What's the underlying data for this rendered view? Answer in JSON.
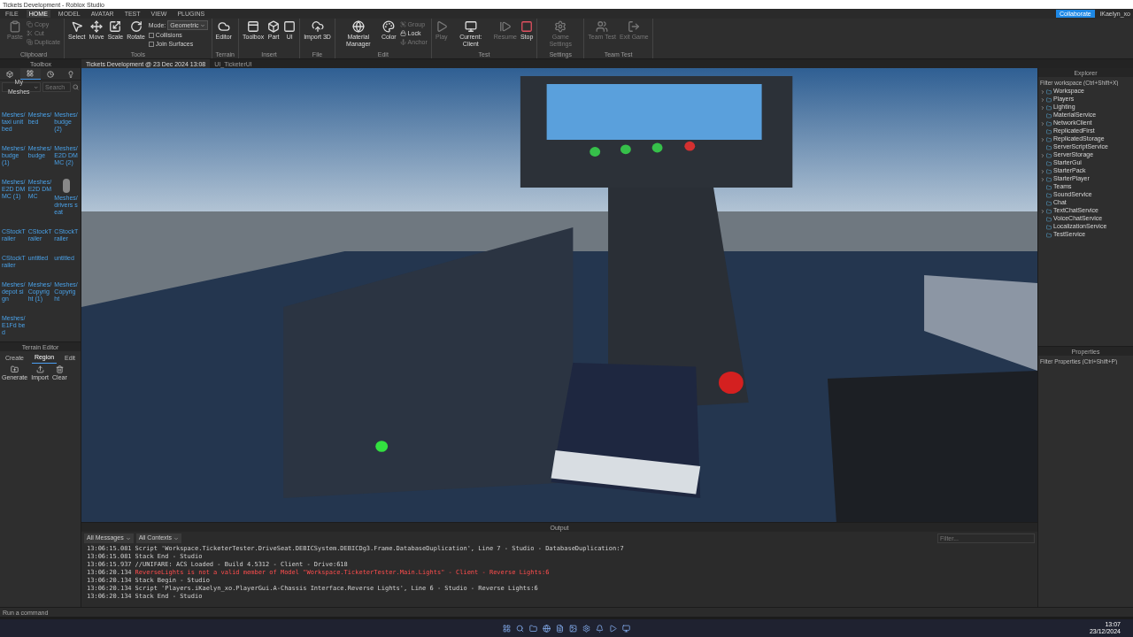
{
  "window": {
    "title": "Tickets Development - Roblox Studio"
  },
  "menu_tabs": [
    {
      "label": "FILE",
      "selected": false
    },
    {
      "label": "HOME",
      "selected": true
    },
    {
      "label": "MODEL",
      "selected": false
    },
    {
      "label": "AVATAR",
      "selected": false
    },
    {
      "label": "TEST",
      "selected": false
    },
    {
      "label": "VIEW",
      "selected": false
    },
    {
      "label": "PLUGINS",
      "selected": false
    }
  ],
  "account": {
    "collaborate": "Collaborate",
    "user": "iKaelyn_xo"
  },
  "ribbon": [
    {
      "group": "Clipboard",
      "tools": [
        {
          "label": "Paste",
          "disabled": true
        }
      ],
      "small": [
        {
          "label": "Copy",
          "disabled": true
        },
        {
          "label": "Cut",
          "disabled": true
        },
        {
          "label": "Duplicate",
          "disabled": true
        }
      ]
    },
    {
      "group": "Tools",
      "tools": [
        {
          "label": "Select",
          "disabled": false
        },
        {
          "label": "Move",
          "disabled": false
        },
        {
          "label": "Scale",
          "disabled": false
        },
        {
          "label": "Rotate",
          "disabled": false
        }
      ],
      "options": [
        {
          "kind": "dropdown",
          "label": "Mode:",
          "value": "Geometric"
        },
        {
          "kind": "checkbox",
          "label": "Collisions",
          "checked": false
        },
        {
          "kind": "checkbox",
          "label": "Join Surfaces",
          "checked": false
        }
      ]
    },
    {
      "group": "Terrain",
      "tools": [
        {
          "label": "Editor",
          "disabled": false
        }
      ]
    },
    {
      "group": "Insert",
      "tools": [
        {
          "label": "Toolbox",
          "disabled": false
        },
        {
          "label": "Part",
          "disabled": false
        },
        {
          "label": "UI",
          "disabled": false
        }
      ]
    },
    {
      "group": "File",
      "tools": [
        {
          "label": "Import 3D",
          "disabled": false
        }
      ]
    },
    {
      "group": "Edit",
      "tools": [
        {
          "label": "Material Manager",
          "disabled": false
        },
        {
          "label": "Color",
          "disabled": false
        }
      ],
      "small": [
        {
          "label": "Group",
          "disabled": true
        },
        {
          "label": "Lock",
          "disabled": false
        },
        {
          "label": "Anchor",
          "disabled": true
        }
      ]
    },
    {
      "group": "Test",
      "tools": [
        {
          "label": "Play",
          "disabled": true
        },
        {
          "label": "Current: Client",
          "disabled": false
        },
        {
          "label": "Resume",
          "disabled": true
        },
        {
          "label": "Stop",
          "disabled": false
        }
      ]
    },
    {
      "group": "Settings",
      "tools": [
        {
          "label": "Game Settings",
          "disabled": true
        }
      ]
    },
    {
      "group": "Team Test",
      "tools": [
        {
          "label": "Team Test",
          "disabled": true
        },
        {
          "label": "Exit Game",
          "disabled": true
        }
      ]
    }
  ],
  "doc_tabs": [
    {
      "label": "Tickets Development @ 23 Dec 2024 13:08",
      "selected": true
    },
    {
      "label": "UI_TicketerUI",
      "selected": false
    }
  ],
  "toolbox": {
    "title": "Toolbox",
    "tabs": [
      {
        "selected": false
      },
      {
        "selected": true
      },
      {
        "selected": false
      },
      {
        "selected": false
      }
    ],
    "category": "My Meshes",
    "search_placeholder": "Search",
    "items": [
      {
        "label": "Meshes/taxi unit bed",
        "thumbnail": false
      },
      {
        "label": "Meshes/bed",
        "thumbnail": false
      },
      {
        "label": "Meshes/budge (2)",
        "thumbnail": false
      },
      {
        "label": "Meshes/budge (1)",
        "thumbnail": false
      },
      {
        "label": "Meshes/budge",
        "thumbnail": false
      },
      {
        "label": "Meshes/E2D DMMC (2)",
        "thumbnail": false
      },
      {
        "label": "Meshes/E2D DMMC (1)",
        "thumbnail": false
      },
      {
        "label": "Meshes/E2D DMMC",
        "thumbnail": false
      },
      {
        "label": "Meshes/drivers seat",
        "thumbnail": true
      },
      {
        "label": "CStockTrailer",
        "thumbnail": false
      },
      {
        "label": "CStockTrailer",
        "thumbnail": false
      },
      {
        "label": "CStockTrailer",
        "thumbnail": false
      },
      {
        "label": "CStockTrailer",
        "thumbnail": false
      },
      {
        "label": "untitled",
        "thumbnail": false
      },
      {
        "label": "untitled",
        "thumbnail": false
      },
      {
        "label": "Meshes/depot sign",
        "thumbnail": false
      },
      {
        "label": "Meshes/Copyright (1)",
        "thumbnail": false
      },
      {
        "label": "Meshes/Copyright",
        "thumbnail": false
      },
      {
        "label": "Meshes/E1Fd bed",
        "thumbnail": false
      }
    ]
  },
  "terrain_editor": {
    "title": "Terrain Editor",
    "tabs": [
      {
        "label": "Create",
        "selected": false
      },
      {
        "label": "Region",
        "selected": true
      },
      {
        "label": "Edit",
        "selected": false
      }
    ],
    "buttons": [
      "Generate",
      "Import",
      "Clear"
    ]
  },
  "explorer": {
    "title": "Explorer",
    "filter_placeholder": "Filter workspace (Ctrl+Shift+X)",
    "items": [
      {
        "label": "Workspace",
        "expandable": true
      },
      {
        "label": "Players",
        "expandable": true
      },
      {
        "label": "Lighting",
        "expandable": true
      },
      {
        "label": "MaterialService",
        "expandable": false
      },
      {
        "label": "NetworkClient",
        "expandable": true
      },
      {
        "label": "ReplicatedFirst",
        "expandable": false
      },
      {
        "label": "ReplicatedStorage",
        "expandable": true
      },
      {
        "label": "ServerScriptService",
        "expandable": false
      },
      {
        "label": "ServerStorage",
        "expandable": true
      },
      {
        "label": "StarterGui",
        "expandable": false
      },
      {
        "label": "StarterPack",
        "expandable": true
      },
      {
        "label": "StarterPlayer",
        "expandable": true
      },
      {
        "label": "Teams",
        "expandable": false
      },
      {
        "label": "SoundService",
        "expandable": false
      },
      {
        "label": "Chat",
        "expandable": false
      },
      {
        "label": "TextChatService",
        "expandable": true
      },
      {
        "label": "VoiceChatService",
        "expandable": false
      },
      {
        "label": "LocalizationService",
        "expandable": false
      },
      {
        "label": "TestService",
        "expandable": false
      }
    ]
  },
  "properties": {
    "title": "Properties",
    "filter_placeholder": "Filter Properties (Ctrl+Shift+P)"
  },
  "output": {
    "title": "Output",
    "filters": [
      "All Messages",
      "All Contexts"
    ],
    "filter_placeholder": "Filter...",
    "lines": [
      {
        "time": "13:06:15.081",
        "text": "Script 'Workspace.TicketerTester.DriveSeat.DEBICSystem.DEBICDg3.Frame.DatabaseDuplication', Line 7  -  Studio - DatabaseDuplication:7",
        "kind": "info"
      },
      {
        "time": "13:06:15.081",
        "text": "Stack End  -  Studio",
        "kind": "info"
      },
      {
        "time": "13:06:15.937",
        "text": "//UNIFARE: ACS Loaded - Build 4.5312  -  Client - Drive:618",
        "kind": "info"
      },
      {
        "time": "13:06:20.134",
        "text": "ReverseLights is not a valid member of Model \"Workspace.TicketerTester.Main.Lights\"  -  Client - Reverse Lights:6",
        "kind": "error"
      },
      {
        "time": "13:06:20.134",
        "text": "Stack Begin  -  Studio",
        "kind": "info"
      },
      {
        "time": "13:06:20.134",
        "text": "Script 'Players.iKaelyn_xo.PlayerGui.A-Chassis Interface.Reverse Lights', Line 6  -  Studio - Reverse Lights:6",
        "kind": "info"
      },
      {
        "time": "13:06:20.134",
        "text": "Stack End  -  Studio",
        "kind": "info"
      }
    ]
  },
  "command_bar": {
    "placeholder": "Run a command"
  },
  "taskbar": {
    "time": "13:07",
    "date": "23/12/2024"
  }
}
